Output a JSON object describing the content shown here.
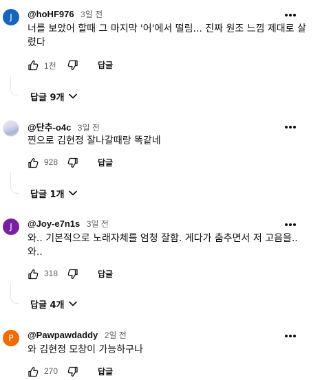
{
  "comments": [
    {
      "avatar_letter": "J",
      "avatar_color": "#1565c0",
      "author": "@hoHF976",
      "time": "3일 전",
      "text": "너를 보았어 할때 그 마지막 '어'에서 떨림... 진짜 원조 느낌 제대로 살렸다",
      "likes": "1천",
      "reply_label": "답글",
      "replies_toggle": "답글 9개"
    },
    {
      "avatar_letter": "",
      "avatar_color": "#c9d2e6",
      "author": "@단추-o4c",
      "time": "3일 전",
      "text": "찐으로 김현정 잘나갈때랑 똑같네",
      "likes": "928",
      "reply_label": "답글",
      "replies_toggle": "답글 1개"
    },
    {
      "avatar_letter": "J",
      "avatar_color": "#7b1fa2",
      "author": "@Joy-e7n1s",
      "time": "3일 전",
      "text": "와.. 기본적으로 노래자체를 엄청 잘함. 게다가 춤추면서 저 고음을.. 와..",
      "likes": "318",
      "reply_label": "답글",
      "replies_toggle": "답글 4개"
    },
    {
      "avatar_letter": "P",
      "avatar_color": "#ef6c00",
      "author": "@Pawpawdaddy",
      "time": "2일 전",
      "text": "와 김현정 모창이 가능하구나",
      "likes": "270",
      "reply_label": "답글"
    }
  ]
}
